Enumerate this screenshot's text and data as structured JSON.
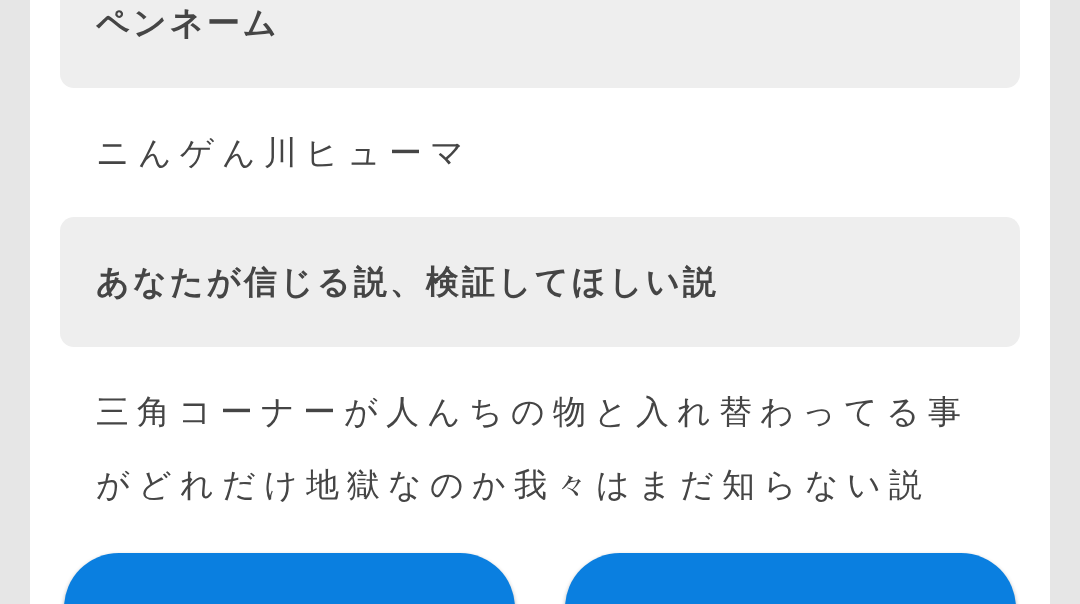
{
  "sections": [
    {
      "heading": "ペンネーム",
      "answer": "ニんゲん川ヒューマ"
    },
    {
      "heading": "あなたが信じる説、検証してほしい説",
      "answer": "三角コーナーが人んちの物と入れ替わってる事がどれだけ地獄なのか我々はまだ知らない説"
    }
  ],
  "buttons": [
    {
      "kind": "primary"
    },
    {
      "kind": "primary"
    }
  ]
}
